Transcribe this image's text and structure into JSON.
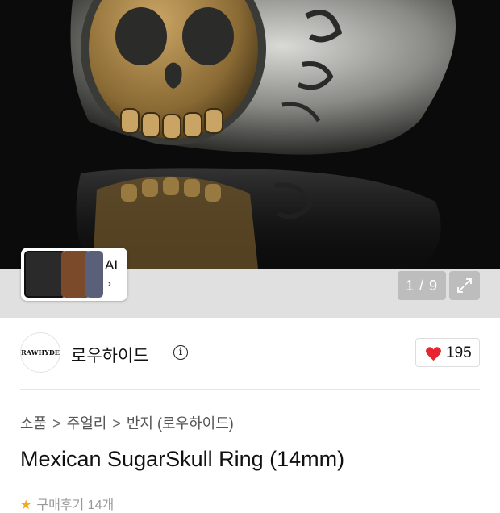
{
  "gallery": {
    "image_alt": "Mexican SugarSkull Ring product photo",
    "ai_label": "AI",
    "ai_chevron": "›",
    "page_indicator": "1 / 9",
    "expand_icon": "expand-icon"
  },
  "shop": {
    "logo_text": "RAWHYDE",
    "name": "로우하이드",
    "info_icon": "info-icon",
    "likes": "195",
    "heart_color": "#e8242f"
  },
  "breadcrumb": {
    "items": [
      "소품",
      "주얼리",
      "반지 (로우하이드)"
    ],
    "separator": ">"
  },
  "product": {
    "title": "Mexican SugarSkull Ring (14mm)",
    "review_text": "구매후기 14개"
  }
}
